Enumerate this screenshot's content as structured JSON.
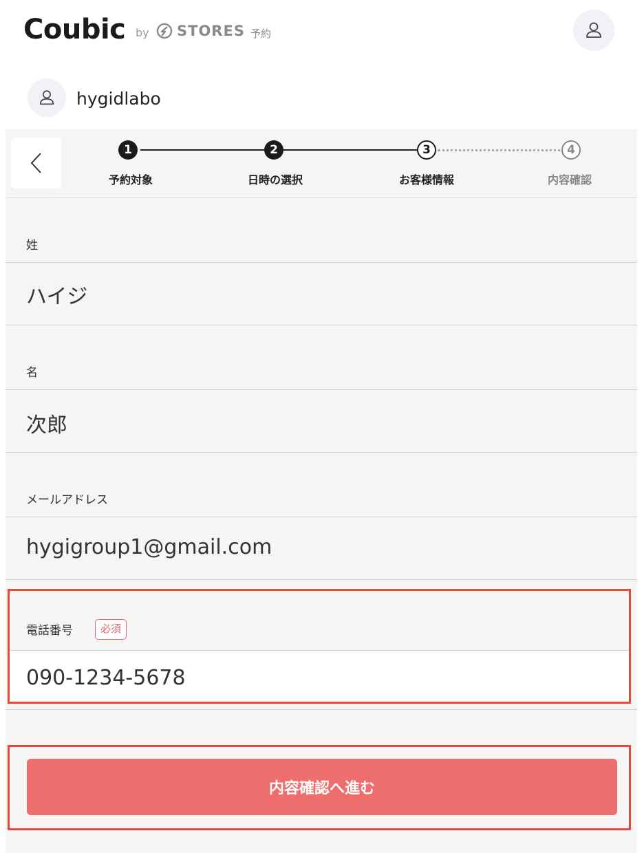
{
  "header": {
    "logo": "Coubic",
    "by": "by",
    "stores": "STORES",
    "stores_suffix": "予約",
    "user_icon": "user-icon"
  },
  "shop": {
    "name": "hygidlabo",
    "avatar_icon": "user-icon"
  },
  "steps": {
    "back_icon": "chevron-left-icon",
    "items": [
      {
        "num": "1",
        "label": "予約対象",
        "state": "done"
      },
      {
        "num": "2",
        "label": "日時の選択",
        "state": "done"
      },
      {
        "num": "3",
        "label": "お客様情報",
        "state": "current"
      },
      {
        "num": "4",
        "label": "内容確認",
        "state": "todo"
      }
    ]
  },
  "form": {
    "last_name": {
      "label": "姓",
      "value": "ハイジ"
    },
    "first_name": {
      "label": "名",
      "value": "次郎"
    },
    "email": {
      "label": "メールアドレス",
      "value": "hygigroup1@gmail.com"
    },
    "phone": {
      "label": "電話番号",
      "required_badge": "必須",
      "value": "090-1234-5678"
    }
  },
  "submit": {
    "label": "内容確認へ進む"
  },
  "colors": {
    "accent": "#ee6e6e",
    "highlight_border": "#e54a37",
    "background": "#f5f5f5"
  }
}
